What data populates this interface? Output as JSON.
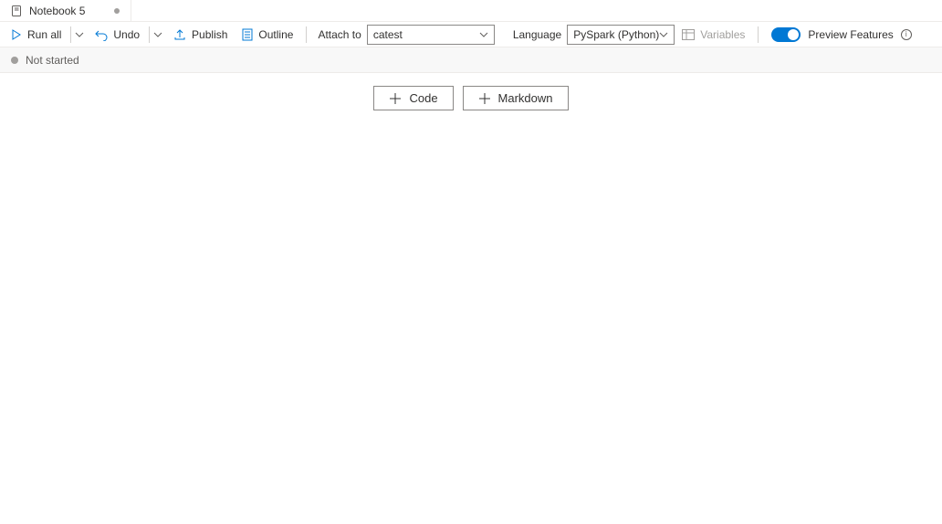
{
  "tab": {
    "title": "Notebook 5"
  },
  "toolbar": {
    "run_all": "Run all",
    "undo": "Undo",
    "publish": "Publish",
    "outline": "Outline",
    "attach_to_label": "Attach to",
    "attach_to_value": "catest",
    "language_label": "Language",
    "language_value": "PySpark (Python)",
    "variables": "Variables",
    "preview_features": "Preview Features"
  },
  "status": {
    "text": "Not started"
  },
  "actions": {
    "code": "Code",
    "markdown": "Markdown"
  }
}
